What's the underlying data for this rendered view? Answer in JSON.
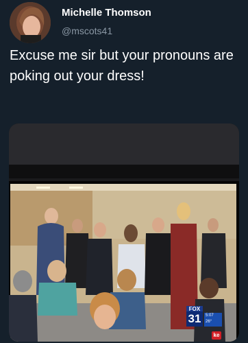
{
  "author": {
    "display_name": "Michelle Thomson",
    "handle": "@mscots41"
  },
  "tweet": {
    "text": "Excuse me sir but your pronouns are poking out your dress!"
  },
  "media": {
    "icon": "photo-of-tv-screen",
    "broadcast_badge": {
      "network": "FOX",
      "channel": "31",
      "time": "5:07",
      "temperature": "26°"
    },
    "corner_logo": "ke"
  },
  "colors": {
    "background": "#15202b",
    "text_primary": "#ffffff",
    "text_secondary": "#8b98a5"
  }
}
